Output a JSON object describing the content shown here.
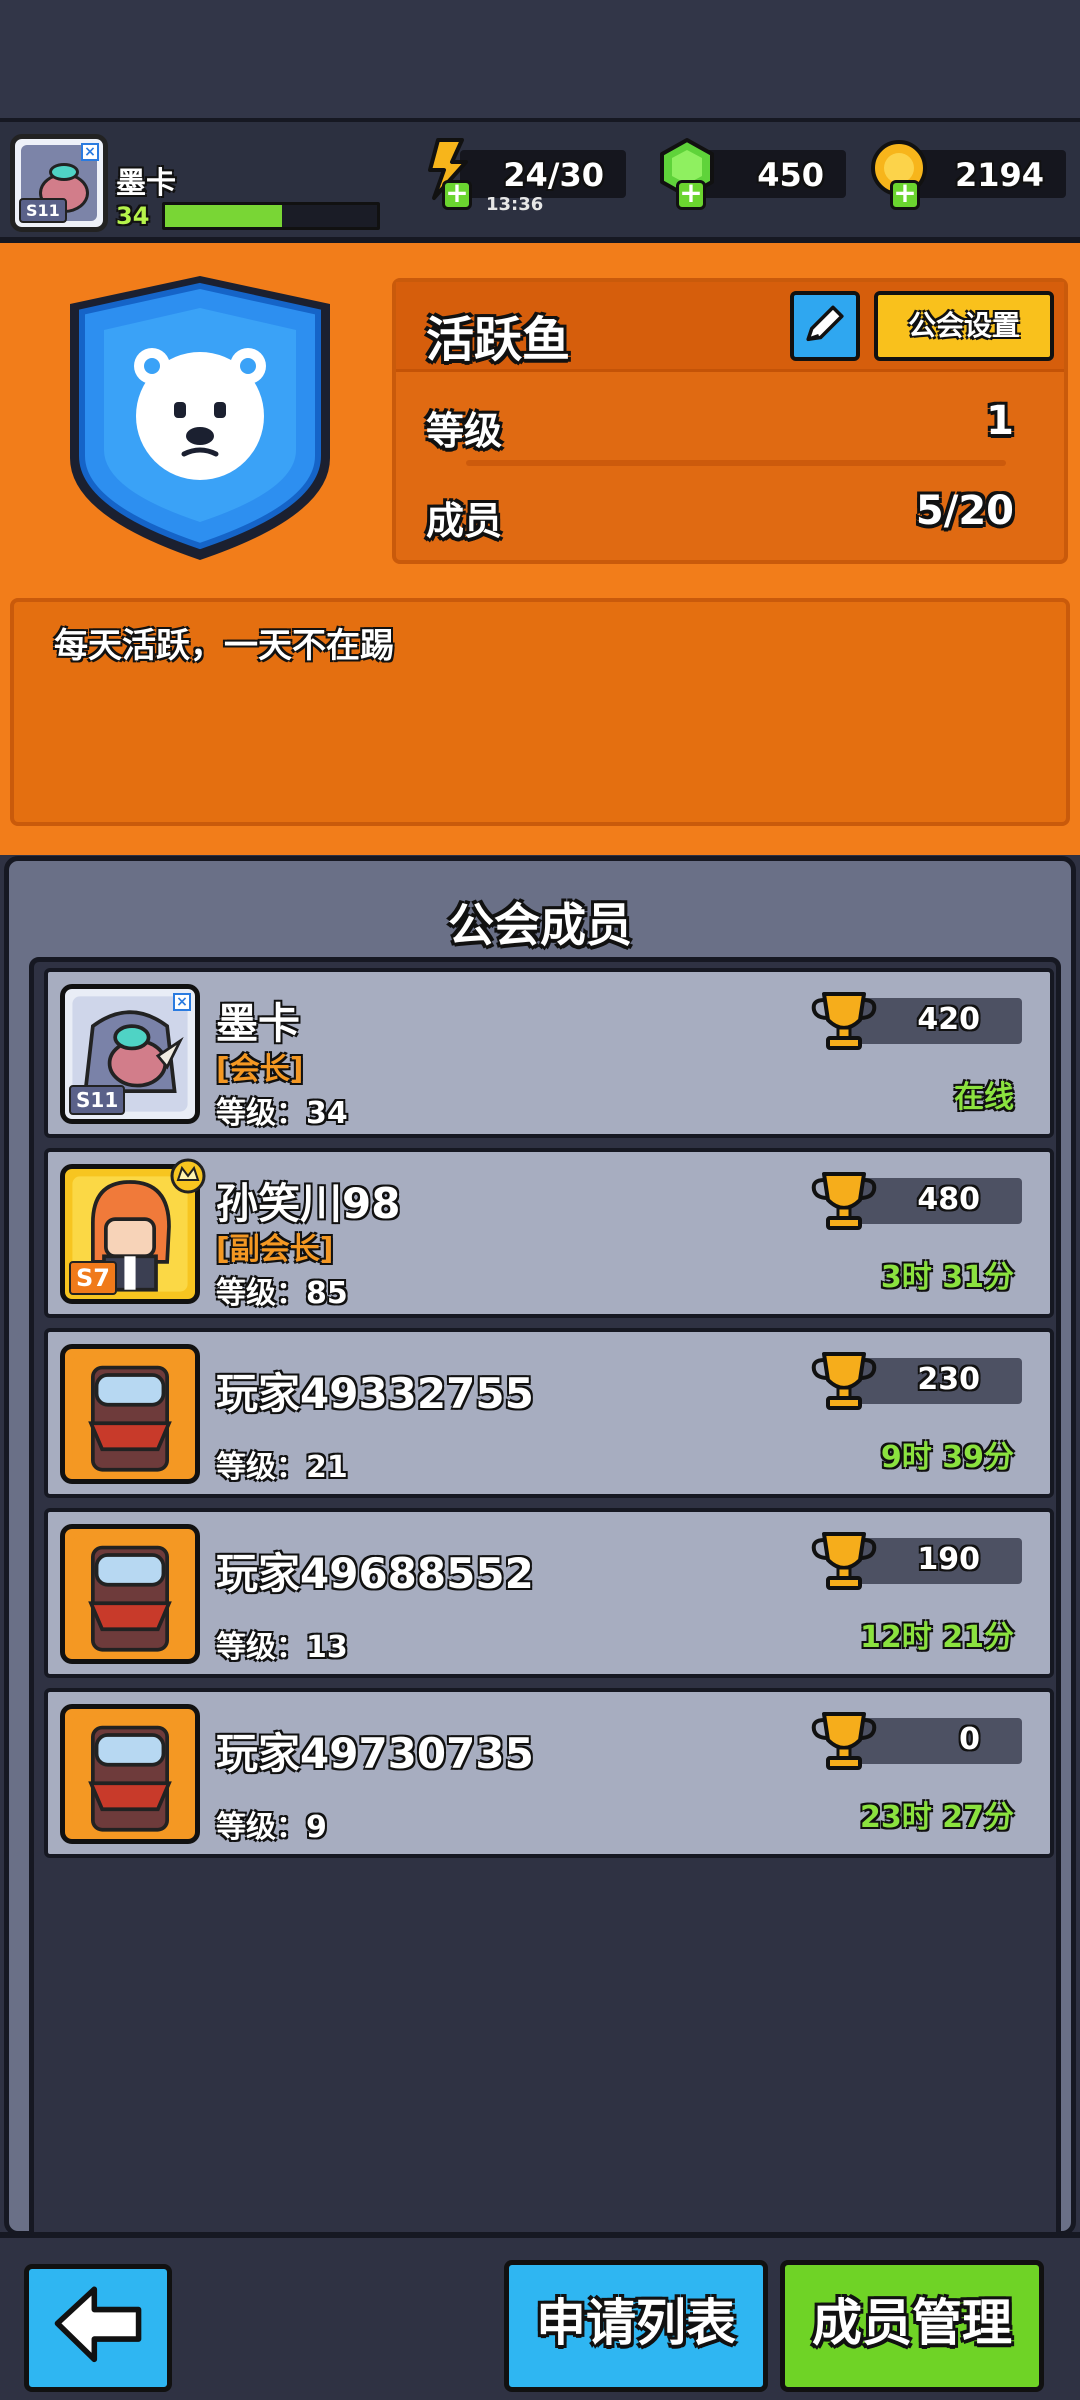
{
  "header": {
    "player_name": "墨卡",
    "player_level": "34",
    "xp_fraction": 0.55,
    "season_badge": "S11",
    "energy": "24/30",
    "energy_timer": "13:36",
    "gems": "450",
    "coins": "2194"
  },
  "guild": {
    "name": "活跃鱼",
    "settings_label": "公会设置",
    "level_label": "等级",
    "level_value": "1",
    "members_label": "成员",
    "members_value": "5/20",
    "description": "每天活跃，一天不在踢"
  },
  "members_panel": {
    "title": "公会成员",
    "members": [
      {
        "name": "墨卡",
        "role": "[会长]",
        "level": "等级：34",
        "trophies": "420",
        "status": "在线",
        "badge": "S11",
        "avatar": "rhino"
      },
      {
        "name": "孙笑川98",
        "role": "[副会长]",
        "level": "等级：85",
        "trophies": "480",
        "status": "3时 31分",
        "badge": "S7",
        "avatar": "redhair"
      },
      {
        "name": "玩家49332755",
        "role": "",
        "level": "等级：21",
        "trophies": "230",
        "status": "9时 39分",
        "badge": "",
        "avatar": "default"
      },
      {
        "name": "玩家49688552",
        "role": "",
        "level": "等级：13",
        "trophies": "190",
        "status": "12时 21分",
        "badge": "",
        "avatar": "default"
      },
      {
        "name": "玩家49730735",
        "role": "",
        "level": "等级：9",
        "trophies": "0",
        "status": "23时 27分",
        "badge": "",
        "avatar": "default"
      }
    ]
  },
  "bottom": {
    "apply_list_label": "申请列表",
    "member_manage_label": "成员管理"
  },
  "colors": {
    "orange_bg": "#f27d1a",
    "online_green": "#8be23f",
    "role_orange": "#f49823"
  }
}
